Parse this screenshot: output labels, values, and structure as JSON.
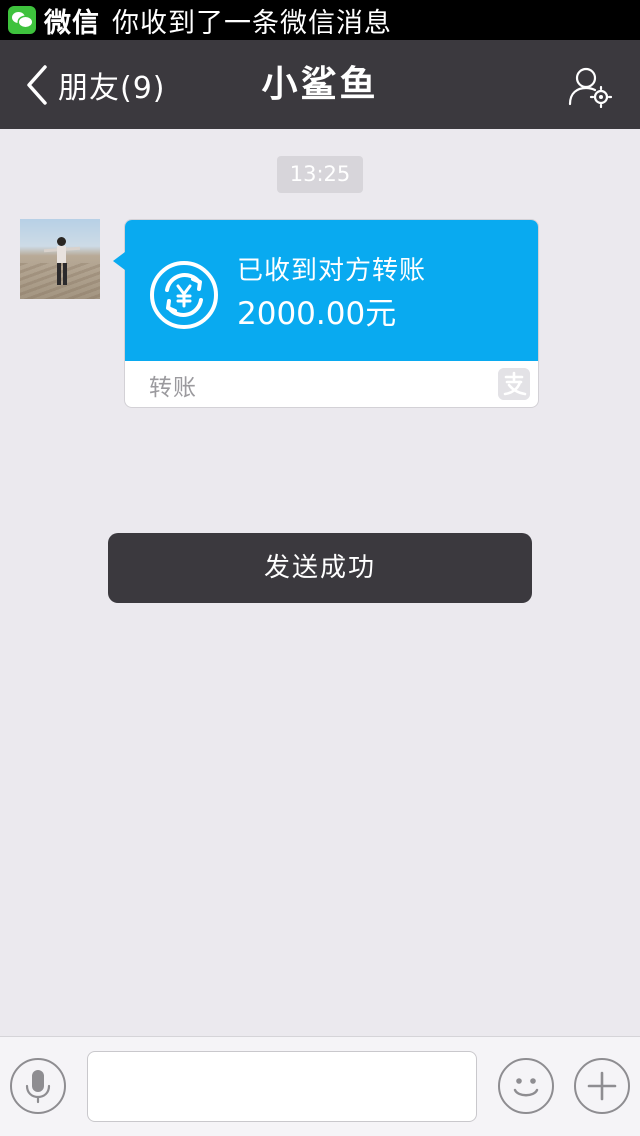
{
  "notification": {
    "app_name": "微信",
    "message": "你收到了一条微信消息",
    "icon": "wechat-icon",
    "icon_color": "#3ec23d"
  },
  "navbar": {
    "back_icon": "chevron-left-icon",
    "back_label": "朋友(9)",
    "title": "小鲨鱼",
    "profile_icon": "user-settings-icon",
    "background": "#3b393e"
  },
  "chat": {
    "timestamp": "13:25",
    "message": {
      "avatar": "user-avatar-photo",
      "transfer_icon": "yuan-transfer-icon",
      "status": "已收到对方转账",
      "amount": "2000.00元",
      "footer_label": "转账",
      "footer_icon": "alipay-icon",
      "accent": "#09aaf0"
    },
    "toast": "发送成功"
  },
  "input_bar": {
    "voice_icon": "microphone-icon",
    "text_value": "",
    "emoji_icon": "smiley-icon",
    "more_icon": "plus-icon"
  }
}
